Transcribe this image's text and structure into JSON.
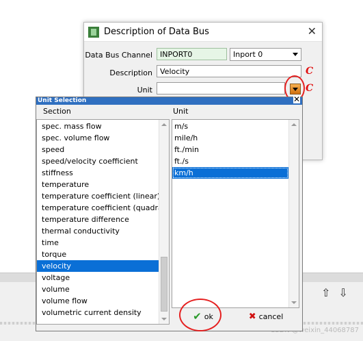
{
  "description_dialog": {
    "title": "Description of Data Bus",
    "channel_label": "Data Bus Channel",
    "channel_value": "INPORT0",
    "inport_selected": "Inport 0",
    "description_label": "Description",
    "description_value": "Velocity",
    "unit_label": "Unit",
    "unit_value": "",
    "annotation_mark": "C"
  },
  "unit_selection": {
    "title": "Unit Selection",
    "section_header": "Section",
    "unit_header": "Unit",
    "sections": [
      "spec. mass flow",
      "spec. volume flow",
      "speed",
      "speed/velocity coefficient",
      "stiffness",
      "temperature",
      "temperature coefficient (linear)",
      "temperature coefficient (quadratic)",
      "temperature difference",
      "thermal conductivity",
      "time",
      "torque",
      "velocity",
      "voltage",
      "volume",
      "volume flow",
      "volumetric current density"
    ],
    "selected_section": "velocity",
    "units": [
      "m/s",
      "mile/h",
      "ft./min",
      "ft./s",
      "km/h"
    ],
    "selected_unit": "km/h",
    "ok_label": "ok",
    "cancel_label": "cancel"
  },
  "watermark": "CSDN @weixin_44068787",
  "colors": {
    "selection": "#0a6fd6",
    "title_bar": "#2f6fc0",
    "annotation": "#e01010"
  }
}
